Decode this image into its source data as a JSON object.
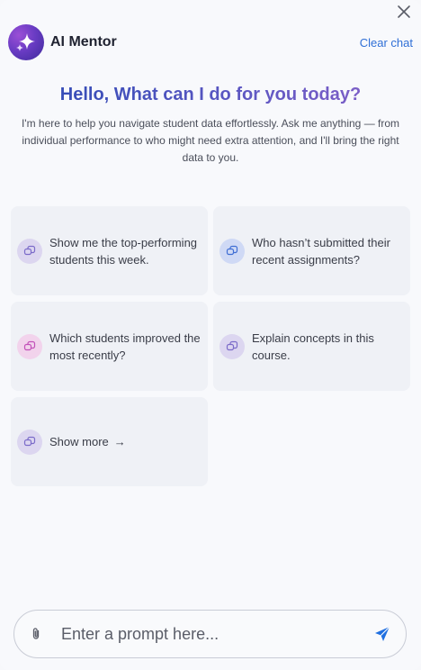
{
  "header": {
    "title": "AI Mentor",
    "clear_label": "Clear chat"
  },
  "welcome": {
    "greeting": "Hello, What can I do for you today?",
    "intro": "I'm here to help you navigate student data effortlessly. Ask me anything — from individual performance to who might need extra attention, and I'll bring the right data to you."
  },
  "suggestions": [
    {
      "label": "Show me the top-performing students this week.",
      "icon": "chat-bubbles-icon",
      "color": "#dcd6f0"
    },
    {
      "label": "Who hasn’t submitted their recent assignments?",
      "icon": "chat-bubbles-icon",
      "color": "#cfd9f5"
    },
    {
      "label": "Which students improved the most recently?",
      "icon": "chat-bubbles-icon",
      "color": "#f2d3ec"
    },
    {
      "label": "Explain concepts in this course.",
      "icon": "chat-bubbles-icon",
      "color": "#dcd6f0"
    }
  ],
  "show_more": {
    "label": "Show more",
    "arrow": "→"
  },
  "composer": {
    "placeholder": "Enter a prompt here...",
    "accent": "#1f6fe0"
  }
}
